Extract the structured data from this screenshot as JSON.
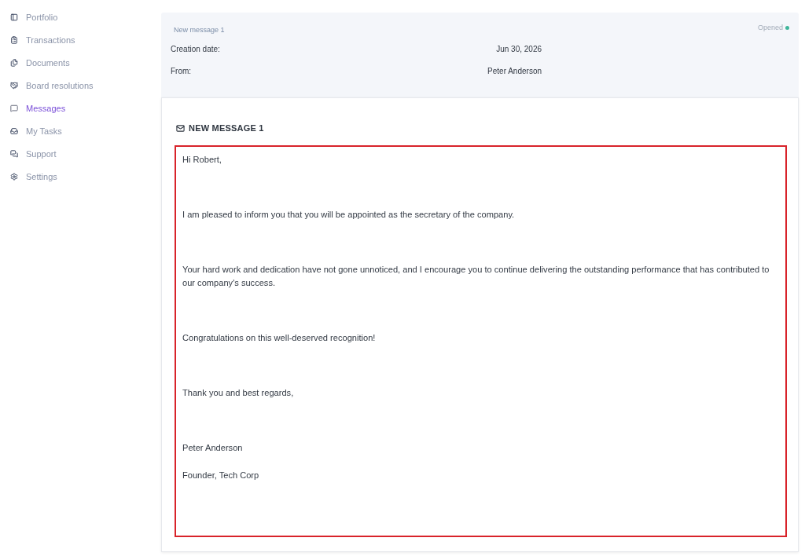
{
  "sidebar": {
    "items": [
      {
        "label": "Portfolio",
        "selected": false
      },
      {
        "label": "Transactions",
        "selected": false
      },
      {
        "label": "Documents",
        "selected": false
      },
      {
        "label": "Board resolutions",
        "selected": false
      },
      {
        "label": "Messages",
        "selected": true
      },
      {
        "label": "My Tasks",
        "selected": false
      },
      {
        "label": "Support",
        "selected": false
      },
      {
        "label": "Settings",
        "selected": false
      }
    ]
  },
  "message_header": {
    "subject": "New message 1",
    "status": "Opened",
    "fields": [
      {
        "label": "Creation date:",
        "value": "Jun 30, 2026"
      },
      {
        "label": "From:",
        "value": "Peter Anderson"
      }
    ]
  },
  "message": {
    "title": "NEW MESSAGE 1",
    "highlighted": true,
    "paragraphs": [
      "Hi Robert,",
      "I am pleased to inform you that you will be appointed as the secretary of the company.",
      "Your hard work and dedication have not gone unnoticed, and I encourage you to continue delivering the outstanding performance that has contributed to our company's success.",
      "Congratulations on this well-deserved recognition!",
      "Thank you and best regards,"
    ],
    "signature": [
      "Peter Anderson",
      "Founder, Tech Corp"
    ]
  }
}
